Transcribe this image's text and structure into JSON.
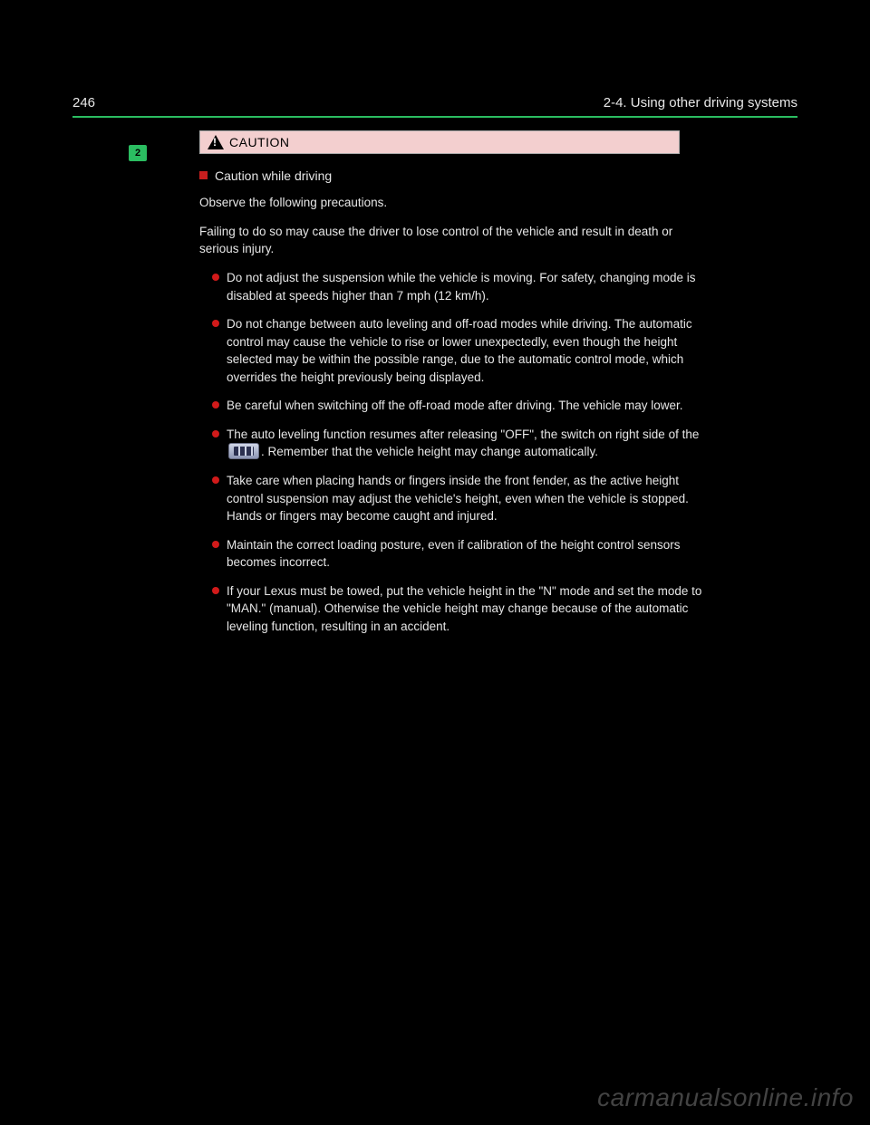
{
  "header": {
    "page_number": "246",
    "title_line": "2-4. Using other driving systems"
  },
  "tab": {
    "label": "2"
  },
  "caution": {
    "label": "CAUTION"
  },
  "section": {
    "title": "Caution while driving",
    "lead_1": "Observe the following precautions.",
    "lead_2": "Failing to do so may cause the driver to lose control of the vehicle and result in death or serious injury.",
    "bullets": [
      "Do not adjust the suspension while the vehicle is moving.\nFor safety, changing mode is disabled at speeds higher than 7 mph (12 km/h).",
      "Do not change between auto leveling and off-road modes while driving.\nThe automatic control may cause the vehicle to rise or lower unexpectedly, even though the height selected may be within the possible range, due to the automatic control mode, which overrides the height previously being displayed.",
      "Be careful when switching off the off-road mode after driving. The vehicle may lower.",
      "The auto leveling function resumes after releasing \"OFF\", the switch on right side of the [ICON]. Remember that the vehicle height may change automatically.",
      "Take care when placing hands or fingers inside the front fender, as the active height control suspension may adjust the vehicle's height, even when the vehicle is stopped.\nHands or fingers may become caught and injured.",
      "Maintain the correct loading posture, even if calibration of the height control sensors becomes incorrect.",
      "If your Lexus must be towed, put the vehicle height in the \"N\" mode and set the mode to \"MAN.\" (manual). Otherwise the vehicle height may change because of the automatic leveling function, resulting in an accident."
    ]
  },
  "watermark": "carmanualsonline.info"
}
